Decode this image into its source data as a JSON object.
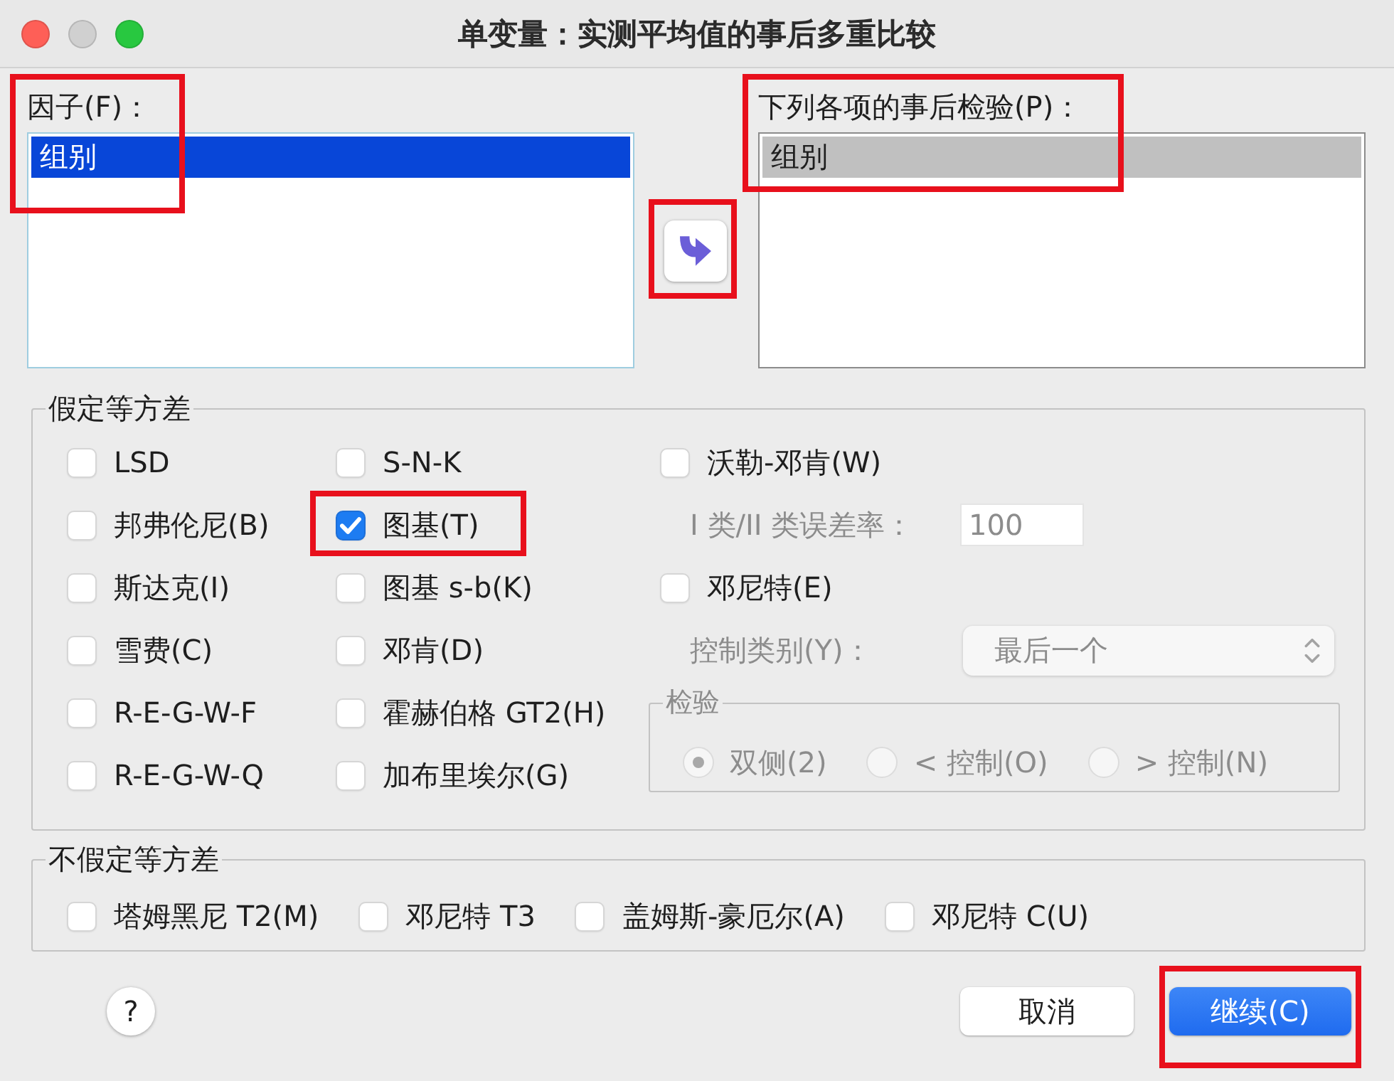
{
  "window": {
    "title": "单变量：实测平均值的事后多重比较",
    "controls": [
      {
        "kind": "close",
        "disabled": false
      },
      {
        "kind": "minimize",
        "disabled": true
      },
      {
        "kind": "zoom",
        "disabled": false
      }
    ]
  },
  "factors": {
    "label": "因子(F)：",
    "focused": true,
    "highlighted": true,
    "items": [
      {
        "text": "组别",
        "selected": true
      }
    ]
  },
  "move_button": {
    "highlighted": true
  },
  "post_hoc_tests": {
    "label": "下列各项的事后检验(P)：",
    "focused": false,
    "highlighted": true,
    "items": [
      {
        "text": "组别",
        "selected": true
      }
    ]
  },
  "equal_variances": {
    "title": "假定等方差",
    "columns": [
      [
        {
          "label": "LSD",
          "checked": false,
          "highlighted": false
        },
        {
          "label": "邦弗伦尼(B)",
          "checked": false,
          "highlighted": false
        },
        {
          "label": "斯达克(I)",
          "checked": false,
          "highlighted": false
        },
        {
          "label": "雪费(C)",
          "checked": false,
          "highlighted": false
        },
        {
          "label": "R-E-G-W-F",
          "checked": false,
          "highlighted": false
        },
        {
          "label": "R-E-G-W-Q",
          "checked": false,
          "highlighted": false
        }
      ],
      [
        {
          "label": "S-N-K",
          "checked": false,
          "highlighted": false
        },
        {
          "label": "图基(T)",
          "checked": true,
          "highlighted": true
        },
        {
          "label": "图基 s-b(K)",
          "checked": false,
          "highlighted": false
        },
        {
          "label": "邓肯(D)",
          "checked": false,
          "highlighted": false
        },
        {
          "label": "霍赫伯格 GT2(H)",
          "checked": false,
          "highlighted": false
        },
        {
          "label": "加布里埃尔(G)",
          "checked": false,
          "highlighted": false
        }
      ]
    ],
    "right_column": [
      {
        "kind": "checkbox",
        "label": "沃勒-邓肯(W)",
        "checked": false
      },
      {
        "kind": "number_field",
        "label": "I 类/II 类误差率：",
        "value": "100",
        "disabled": true
      },
      {
        "kind": "checkbox",
        "label": "邓尼特(E)",
        "checked": false
      },
      {
        "kind": "select",
        "label": "控制类别(Y)：",
        "value": "最后一个",
        "disabled": true
      },
      {
        "kind": "test_group",
        "title": "检验",
        "disabled": true,
        "options": [
          {
            "label": "双侧(2)",
            "selected": true
          },
          {
            "label": "< 控制(O)",
            "selected": false
          },
          {
            "label": "> 控制(N)",
            "selected": false
          }
        ]
      }
    ]
  },
  "unequal_variances": {
    "title": "不假定等方差",
    "options": [
      {
        "label": "塔姆黑尼 T2(M)",
        "checked": false
      },
      {
        "label": "邓尼特 T3",
        "checked": false
      },
      {
        "label": "盖姆斯-豪厄尔(A)",
        "checked": false
      },
      {
        "label": "邓尼特 C(U)",
        "checked": false
      }
    ]
  },
  "help_button": {
    "text": "?"
  },
  "buttons": [
    {
      "kind": "cancel",
      "label": "取消",
      "default": false,
      "highlighted": false
    },
    {
      "kind": "continue",
      "label": "继续(C)",
      "default": true,
      "highlighted": true
    }
  ]
}
